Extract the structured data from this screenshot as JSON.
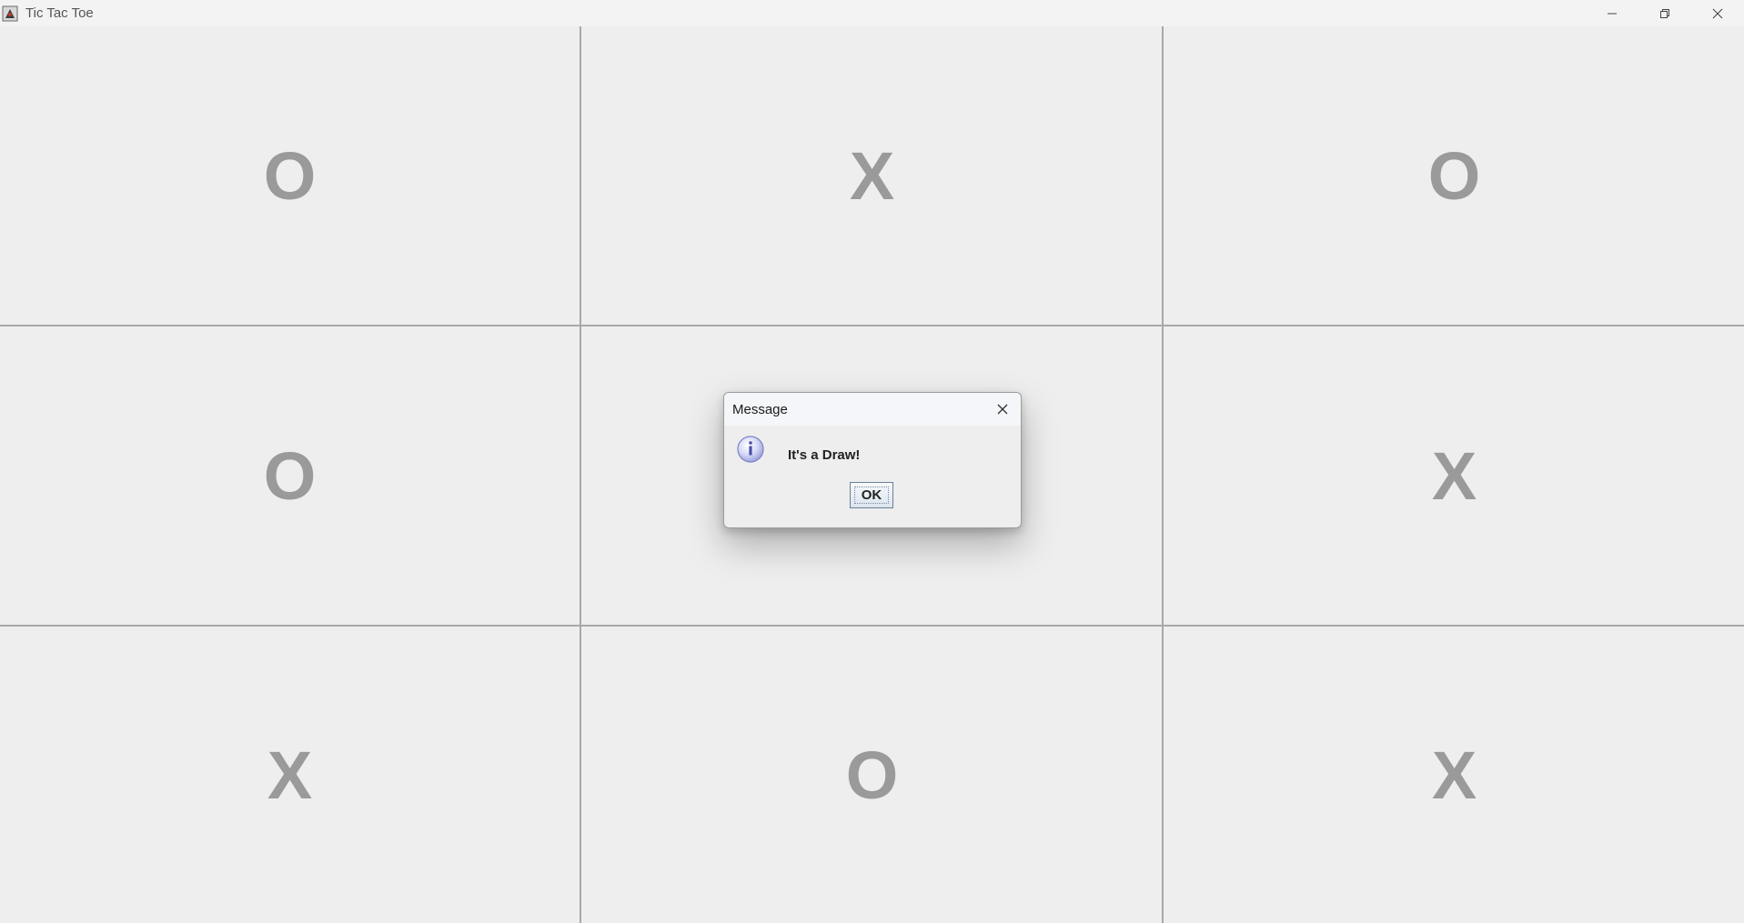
{
  "window": {
    "title": "Tic Tac Toe",
    "icon": "java-duke-icon",
    "controls": [
      "minimize-icon",
      "restore-icon",
      "close-icon"
    ]
  },
  "board": {
    "cells": [
      [
        "O",
        "X",
        "O"
      ],
      [
        "O",
        "",
        "X"
      ],
      [
        "X",
        "O",
        "X"
      ]
    ],
    "mark_color": "#9a9a9a",
    "grid_color": "#a8a8a8"
  },
  "dialog": {
    "title": "Message",
    "icon": "information-icon",
    "message": "It's a Draw!",
    "ok_label": "OK"
  }
}
